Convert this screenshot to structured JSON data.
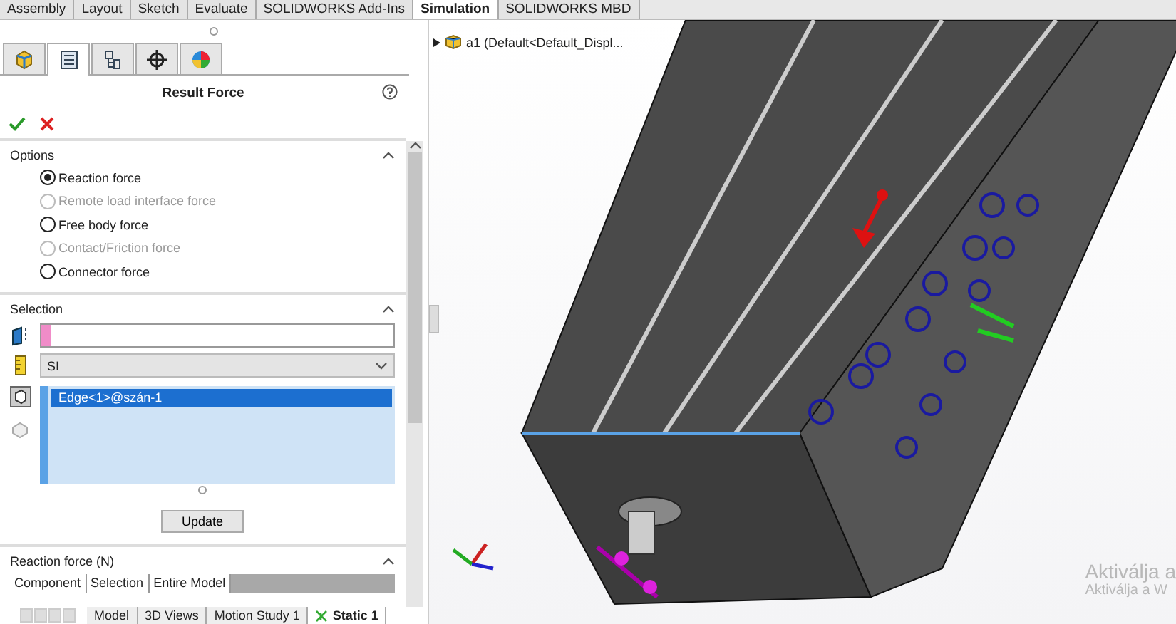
{
  "command_tabs": [
    {
      "label": "Assembly",
      "selected": false
    },
    {
      "label": "Layout",
      "selected": false
    },
    {
      "label": "Sketch",
      "selected": false
    },
    {
      "label": "Evaluate",
      "selected": false
    },
    {
      "label": "SOLIDWORKS Add-Ins",
      "selected": false
    },
    {
      "label": "Simulation",
      "selected": true
    },
    {
      "label": "SOLIDWORKS MBD",
      "selected": false
    }
  ],
  "panel_tabs": [
    {
      "kind": "part",
      "selected": false
    },
    {
      "kind": "list",
      "selected": true
    },
    {
      "kind": "config",
      "selected": false
    },
    {
      "kind": "target",
      "selected": false
    },
    {
      "kind": "appearance",
      "selected": false
    }
  ],
  "title": "Result Force",
  "options": {
    "heading": "Options",
    "radios": [
      {
        "label": "Reaction force",
        "selected": true,
        "disabled": false
      },
      {
        "label": "Remote load interface force",
        "selected": false,
        "disabled": true
      },
      {
        "label": "Free body force",
        "selected": false,
        "disabled": false
      },
      {
        "label": "Contact/Friction force",
        "selected": false,
        "disabled": true
      },
      {
        "label": "Connector force",
        "selected": false,
        "disabled": false
      }
    ]
  },
  "selection": {
    "heading": "Selection",
    "units": "SI",
    "items": [
      {
        "label": "Edge<1>@szán-1",
        "selected": true
      }
    ],
    "button": "Update"
  },
  "reaction": {
    "heading": "Reaction force (N)",
    "columns": [
      "Component",
      "Selection",
      "Entire Model"
    ]
  },
  "bottom_tabs": [
    {
      "label": "Model",
      "selected": false
    },
    {
      "label": "3D Views",
      "selected": false
    },
    {
      "label": "Motion Study 1",
      "selected": false
    },
    {
      "label": "Static 1",
      "selected": true
    }
  ],
  "tree": {
    "label": "a1  (Default<Default_Displ...",
    "expanded": false
  },
  "activation_notice": [
    "Aktiválja a",
    "Aktiválja a W"
  ]
}
